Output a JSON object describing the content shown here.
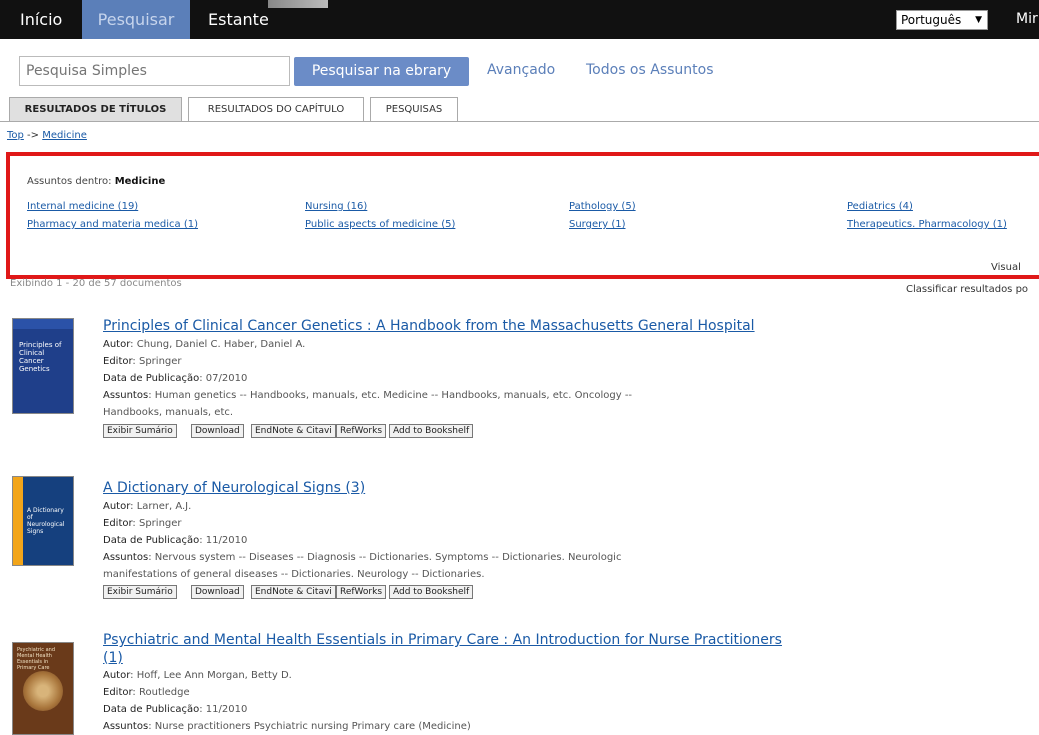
{
  "topbar": {
    "nav": [
      "Início",
      "Pesquisar",
      "Estante"
    ],
    "language": "Português",
    "user": "Mir"
  },
  "search": {
    "placeholder": "Pesquisa Simples",
    "button": "Pesquisar na ebrary",
    "advanced": "Avançado",
    "all_subjects": "Todos os Assuntos"
  },
  "tabs": [
    "RESULTADOS DE TÍTULOS",
    "RESULTADOS DO CAPÍTULO",
    "PESQUISAS"
  ],
  "breadcrumb": {
    "top": "Top",
    "sep": " -> ",
    "current": "Medicine"
  },
  "subjects": {
    "label": "Assuntos dentro: ",
    "parent": "Medicine",
    "items": [
      "Internal medicine (19)",
      "Nursing (16)",
      "Pathology (5)",
      "Pediatrics (4)",
      "Pharmacy and materia medica (1)",
      "Public aspects of medicine (5)",
      "Surgery (1)",
      "Therapeutics. Pharmacology (1)"
    ],
    "visual": "Visual"
  },
  "showing": "Exibindo 1 - 20 de 57 documentos",
  "sort_label": "Classificar resultados po",
  "labels": {
    "author": "Autor",
    "publisher": "Editor",
    "date": "Data de Publicação",
    "subjects": "Assuntos"
  },
  "buttons": [
    "Exibir Sumário",
    "Download",
    "EndNote & Citavi",
    "RefWorks",
    "Add to Bookshelf"
  ],
  "results": [
    {
      "title": "Principles of Clinical Cancer Genetics : A Handbook from the Massachusetts General Hospital",
      "author": "Chung, Daniel C.   Haber, Daniel A.",
      "publisher": "Springer",
      "date": "07/2010",
      "subjects_line1": "Human genetics -- Handbooks, manuals, etc.   Medicine -- Handbooks, manuals, etc.   Oncology --",
      "subjects_line2": "Handbooks, manuals, etc.",
      "cover_title": "Principles of Clinical Cancer Genetics"
    },
    {
      "title": "A Dictionary of Neurological Signs (3)",
      "author": "Larner, A.J.",
      "publisher": "Springer",
      "date": "11/2010",
      "subjects_line1": "Nervous system -- Diseases -- Diagnosis -- Dictionaries.   Symptoms -- Dictionaries.   Neurologic",
      "subjects_line2": "manifestations of general diseases -- Dictionaries.   Neurology -- Dictionaries.",
      "cover_title": "A Dictionary of Neurological Signs"
    },
    {
      "title_line1": "Psychiatric and Mental Health Essentials in Primary Care : An Introduction for Nurse Practitioners",
      "title_line2": "(1)",
      "author": "Hoff, Lee Ann   Morgan, Betty D.",
      "publisher": "Routledge",
      "date": "11/2010",
      "subjects_line1": "Nurse practitioners   Psychiatric nursing   Primary care (Medicine)",
      "cover_title": "Psychiatric and Mental Health Essentials in Primary Care"
    }
  ]
}
